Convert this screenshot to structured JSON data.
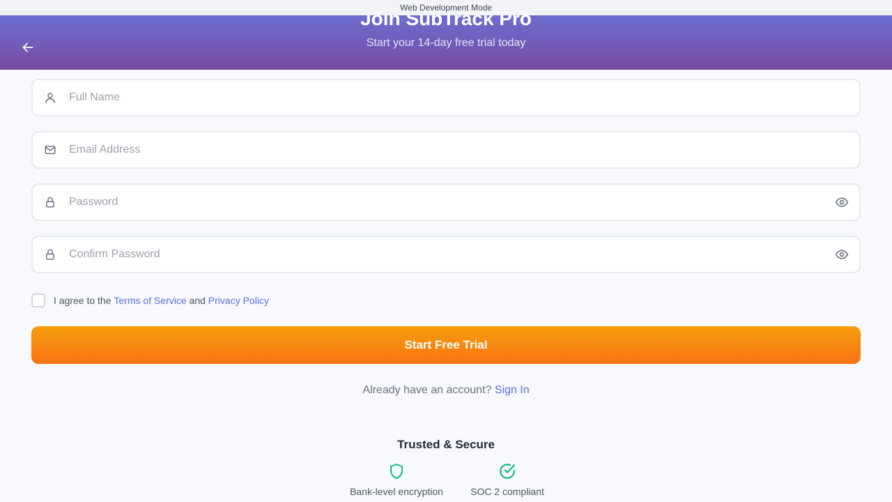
{
  "devbar": {
    "label": "Web Development Mode"
  },
  "header": {
    "title": "Join SubTrack Pro",
    "subtitle": "Start your 14-day free trial today",
    "back_icon": "arrow-left-icon"
  },
  "form": {
    "fields": [
      {
        "icon": "user-icon",
        "placeholder": "Full Name",
        "value": ""
      },
      {
        "icon": "mail-icon",
        "placeholder": "Email Address",
        "value": ""
      },
      {
        "icon": "lock-icon",
        "placeholder": "Password",
        "value": "",
        "toggle_icon": "eye-icon"
      },
      {
        "icon": "lock-icon",
        "placeholder": "Confirm Password",
        "value": "",
        "toggle_icon": "eye-icon"
      }
    ],
    "agree": {
      "checked": false,
      "prefix": "I agree to the",
      "terms_link": "Terms of Service",
      "conjunction": "and",
      "privacy_link": "Privacy Policy"
    },
    "submit_label": "Start Free Trial"
  },
  "signin": {
    "prompt": "Already have an account?",
    "link": "Sign In"
  },
  "trust": {
    "title": "Trusted & Secure",
    "badges": [
      {
        "icon": "shield-icon",
        "label": "Bank-level encryption"
      },
      {
        "icon": "check-circle-icon",
        "label": "SOC 2 compliant"
      }
    ]
  },
  "colors": {
    "header_gradient_start": "#6b77de",
    "header_gradient_end": "#764ba2",
    "cta_gradient_start": "#f59e0b",
    "cta_gradient_end": "#f97316",
    "link": "#5a6fdc",
    "trust_icon": "#10b981"
  }
}
